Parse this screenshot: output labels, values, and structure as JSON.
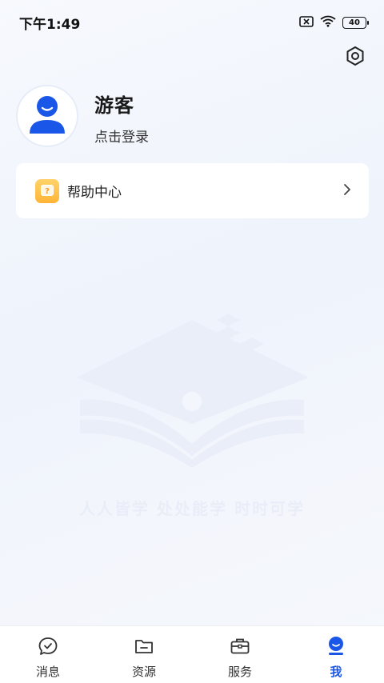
{
  "status_bar": {
    "time": "下午1:49",
    "battery": "40"
  },
  "profile": {
    "name": "游客",
    "login_link": "点击登录"
  },
  "menu": {
    "help_center": "帮助中心"
  },
  "watermark": {
    "slogan": "人人皆学  处处能学    时时可学"
  },
  "tabs": [
    {
      "label": "消息",
      "icon": "chat-check-icon"
    },
    {
      "label": "资源",
      "icon": "folder-icon"
    },
    {
      "label": "服务",
      "icon": "briefcase-icon"
    },
    {
      "label": "我",
      "icon": "user-icon",
      "active": true
    }
  ],
  "colors": {
    "accent": "#1a56e8",
    "help_icon": "#ffb436"
  }
}
